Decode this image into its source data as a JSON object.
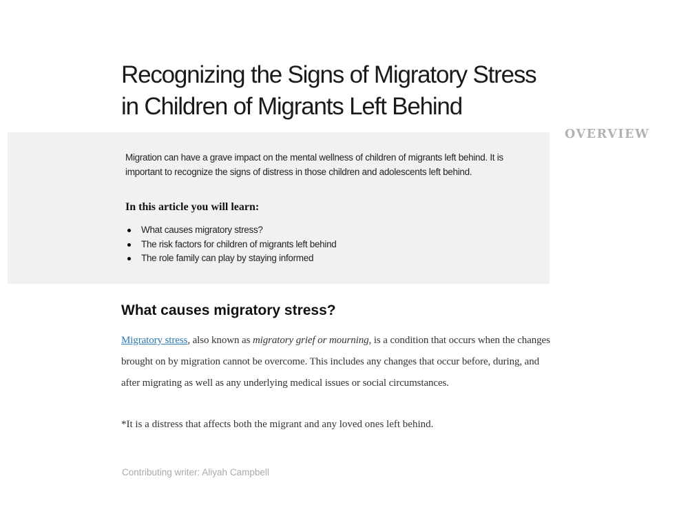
{
  "article": {
    "title": "Recognizing the Signs of Migratory Stress in Children of Migrants Left Behind"
  },
  "sidebar": {
    "overview_label": "OVERVIEW"
  },
  "overview": {
    "intro": "Migration can have a grave impact on the mental wellness of children of migrants left behind. It is important to recognize the signs of distress in those children and adolescents left behind.",
    "learn_heading": "In this article you will learn:",
    "items": [
      "What causes migratory stress?",
      "The risk factors for children of migrants left behind",
      "The role family can play by staying informed"
    ]
  },
  "section": {
    "heading": "What causes migratory stress?",
    "link_text": "Migratory stress",
    "text_after_link": ", also known as ",
    "emphasis": "migratory grief or mourning",
    "text_rest": ", is a condition that occurs when the changes brought on by migration cannot be overcome. This includes any changes that occur before, during, and after migrating as well as any underlying medical issues or social circumstances.",
    "note": "*It is a distress that affects both the migrant and any loved ones left behind."
  },
  "footer": {
    "writer_credit": "Contributing writer: Aliyah Campbell"
  },
  "colors": {
    "overview_background": "#f1f1f1",
    "link": "#2a7ab0",
    "overview_label": "#b2b2b2",
    "writer_text": "#a9a9a9"
  }
}
